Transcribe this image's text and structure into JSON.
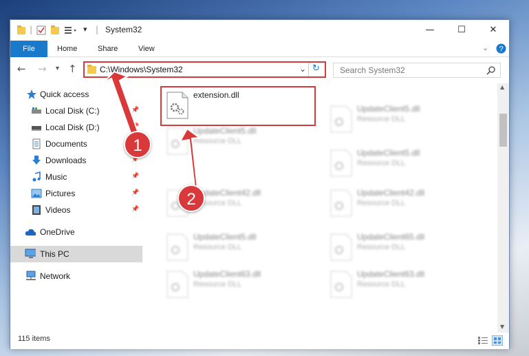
{
  "window": {
    "title": "System32",
    "controls": {
      "minimize": "—",
      "maximize": "☐",
      "close": "✕"
    }
  },
  "ribbon": {
    "tabs": [
      "File",
      "Home",
      "Share",
      "View"
    ]
  },
  "address": {
    "path": "C:\\Windows\\System32"
  },
  "search": {
    "placeholder": "Search System32"
  },
  "sidebar": {
    "items": [
      {
        "label": "Quick access",
        "icon": "star-icon",
        "pinned": false
      },
      {
        "label": "Local Disk (C:)",
        "icon": "drive-icon",
        "pinned": true
      },
      {
        "label": "Local Disk (D:)",
        "icon": "drive-icon",
        "pinned": true
      },
      {
        "label": "Documents",
        "icon": "documents-icon",
        "pinned": true
      },
      {
        "label": "Downloads",
        "icon": "downloads-icon",
        "pinned": true
      },
      {
        "label": "Music",
        "icon": "music-icon",
        "pinned": true
      },
      {
        "label": "Pictures",
        "icon": "pictures-icon",
        "pinned": true
      },
      {
        "label": "Videos",
        "icon": "videos-icon",
        "pinned": true
      },
      {
        "label": "OneDrive",
        "icon": "cloud-icon",
        "pinned": false
      },
      {
        "label": "This PC",
        "icon": "computer-icon",
        "pinned": false,
        "selected": true
      },
      {
        "label": "Network",
        "icon": "network-icon",
        "pinned": false
      }
    ]
  },
  "files": {
    "highlighted": {
      "name": "extension.dll",
      "type": ""
    },
    "blurred_left": [
      {
        "name": "UpdateClient5.dll",
        "type": "Resource DLL"
      },
      {
        "name": "UpdateClient42.dll",
        "type": "Resource DLL"
      },
      {
        "name": "UpdateClient5.dll",
        "type": "Resource DLL"
      },
      {
        "name": "UpdateClient63.dll",
        "type": "Resource DLL"
      }
    ],
    "blurred_right": [
      {
        "name": "UpdateClient5.dll",
        "type": "Resource DLL"
      },
      {
        "name": "UpdateClient5.dll",
        "type": "Resource DLL"
      },
      {
        "name": "UpdateClient42.dll",
        "type": "Resource DLL"
      },
      {
        "name": "UpdateClient65.dll",
        "type": "Resource DLL"
      },
      {
        "name": "UpdateClient63.dll",
        "type": "Resource DLL"
      }
    ]
  },
  "status": {
    "item_count": "115 items"
  },
  "annotations": {
    "badge_1": "1",
    "badge_2": "2",
    "color": "#d9393b"
  }
}
